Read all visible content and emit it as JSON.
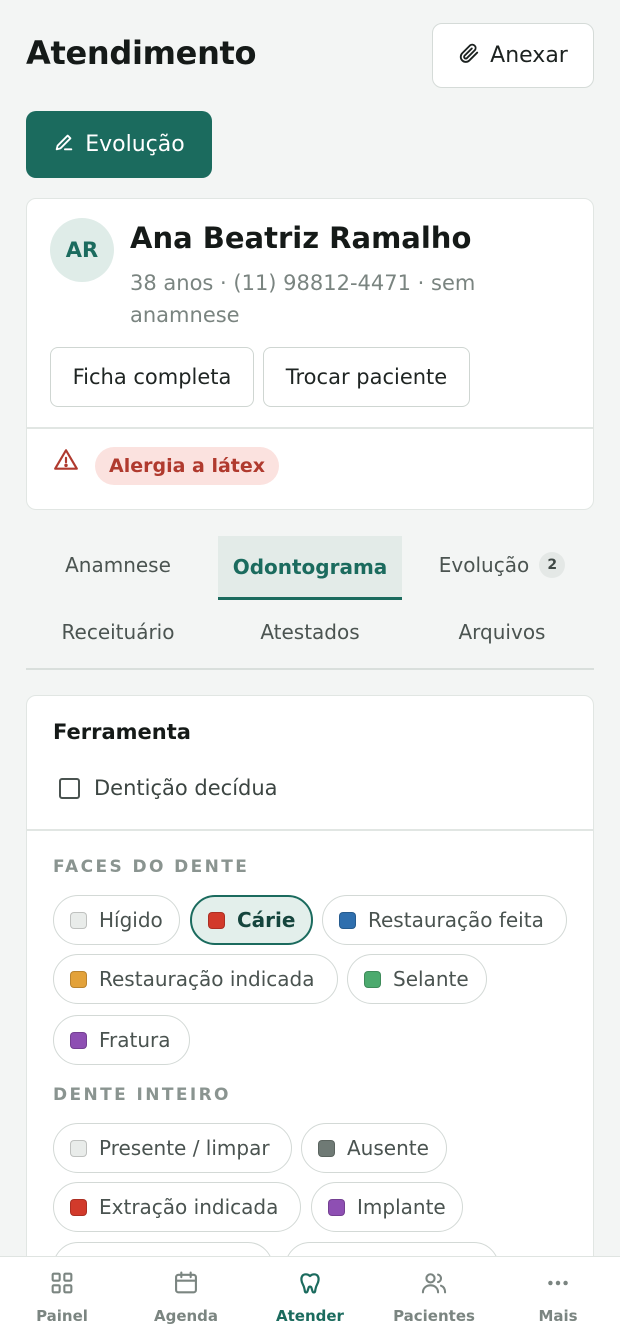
{
  "header": {
    "title": "Atendimento",
    "attach_label": "Anexar",
    "evolution_label": "Evolução"
  },
  "patient": {
    "initials": "AR",
    "name": "Ana Beatriz Ramalho",
    "meta": "38 anos · (11) 98812-4471 · sem anamnese",
    "buttons": {
      "full_record": "Ficha completa",
      "switch_patient": "Trocar paciente"
    },
    "alert": "Alergia a látex"
  },
  "tabs": [
    {
      "label": "Anamnese",
      "active": false
    },
    {
      "label": "Odontograma",
      "active": true
    },
    {
      "label": "Evolução",
      "badge": "2",
      "active": false
    },
    {
      "label": "Receituário",
      "active": false
    },
    {
      "label": "Atestados",
      "active": false
    },
    {
      "label": "Arquivos",
      "active": false
    }
  ],
  "tool": {
    "title": "Ferramenta",
    "deciduous_label": "Dentição decídua",
    "deciduous_checked": false,
    "faces_label": "FACES DO DENTE",
    "faces": [
      {
        "label": "Hígido",
        "color": "#e9ecea",
        "active": false
      },
      {
        "label": "Cárie",
        "color": "#d23a2b",
        "active": true
      },
      {
        "label": "Restauração feita",
        "color": "#2f6fae",
        "active": false
      },
      {
        "label": "Restauração indicada",
        "color": "#e3a23a",
        "active": false
      },
      {
        "label": "Selante",
        "color": "#4caa6e",
        "active": false
      },
      {
        "label": "Fratura",
        "color": "#8e4fb3",
        "active": false
      }
    ],
    "whole_label": "DENTE INTEIRO",
    "whole": [
      {
        "label": "Presente / limpar",
        "color": "#e9ecea",
        "active": false
      },
      {
        "label": "Ausente",
        "color": "#6f7a75",
        "active": false
      },
      {
        "label": "Extração indicada",
        "color": "#d23a2b",
        "active": false
      },
      {
        "label": "Implante",
        "color": "#8e4fb3",
        "active": false
      }
    ]
  },
  "nav": [
    {
      "label": "Painel",
      "icon": "grid-icon",
      "active": false
    },
    {
      "label": "Agenda",
      "icon": "calendar-icon",
      "active": false
    },
    {
      "label": "Atender",
      "icon": "tooth-icon",
      "active": true
    },
    {
      "label": "Pacientes",
      "icon": "users-icon",
      "active": false
    },
    {
      "label": "Mais",
      "icon": "more-icon",
      "active": false
    }
  ],
  "colors": {
    "brand": "#1b6b5e",
    "alert_bg": "#fbe2df",
    "alert_text": "#b03a2e"
  }
}
